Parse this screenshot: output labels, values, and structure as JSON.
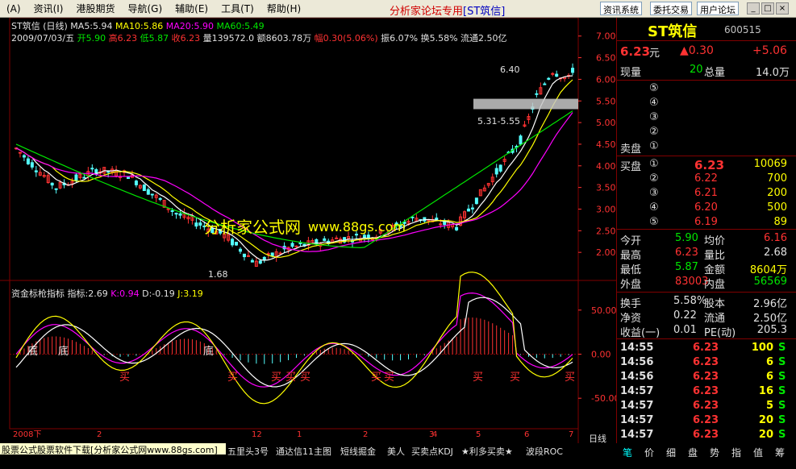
{
  "menu": {
    "items": [
      "(A)",
      "资讯(I)",
      "港股期货",
      "导航(G)",
      "辅助(E)",
      "工具(T)",
      "帮助(H)"
    ],
    "center_title": "分析家论坛专用",
    "center_title_stock": "[ST筑信]",
    "right_buttons": [
      "资讯系统",
      "委托交易",
      "用户论坛"
    ],
    "window_buttons": [
      "_",
      "□",
      "×"
    ]
  },
  "chart": {
    "info_line1": {
      "name": "ST筑信",
      "period": "(日线)",
      "ma5": "MA5:5.94",
      "ma10": "MA10:5.86",
      "ma20": "MA20:5.90",
      "ma60": "MA60:5.49"
    },
    "info_line2": {
      "date": "2009/07/03/五",
      "open": "开5.90",
      "high": "高6.23",
      "low": "低5.87",
      "close": "收6.23",
      "volume": "量139572.0",
      "amount": "额8603.78万",
      "change": "幅0.30(5.06%)",
      "amplitude": "振6.07%",
      "turnover": "换5.58%",
      "float": "流通2.50亿"
    },
    "price_axis": [
      "7.00",
      "6.50",
      "6.00",
      "5.50",
      "5.00",
      "4.50",
      "4.00",
      "3.50",
      "3.00",
      "2.50",
      "2.00"
    ],
    "annotations": {
      "high": "6.40",
      "low": "1.68",
      "range": "5.31-5.55"
    },
    "watermark": "分析家公式网",
    "watermark_url": "www.88gs.com",
    "indicator_title": "资金标枪指标",
    "indicator_values": {
      "zb": "指标:2.69",
      "k": "K:0.94",
      "d": "D:-0.19",
      "j": "J:3.19"
    },
    "indicator_axis": [
      "50.00",
      "0.00",
      "-50.00"
    ],
    "signal_di": "底",
    "signal_mai": "买",
    "date_axis": [
      "2008下",
      "2",
      "12",
      "1",
      "2",
      "3",
      "4",
      "5",
      "6",
      "7"
    ],
    "period_label": "日线"
  },
  "quote": {
    "name": "ST筑信",
    "code": "600515",
    "price": "6.23",
    "price_unit": "元",
    "change": "▲0.30",
    "change_pct": "+5.06",
    "now_vol_label": "现量",
    "now_vol": "20",
    "total_vol_label": "总量",
    "total_vol": "14.0万",
    "sell_label": "卖盘",
    "sell_levels": [
      "⑤",
      "④",
      "③",
      "②",
      "①"
    ],
    "buy_label": "买盘",
    "buy_levels": [
      {
        "lvl": "①",
        "price": "6.23",
        "vol": "10069"
      },
      {
        "lvl": "②",
        "price": "6.22",
        "vol": "700"
      },
      {
        "lvl": "③",
        "price": "6.21",
        "vol": "200"
      },
      {
        "lvl": "④",
        "price": "6.20",
        "vol": "500"
      },
      {
        "lvl": "⑤",
        "price": "6.19",
        "vol": "89"
      }
    ],
    "stats": [
      {
        "l1": "今开",
        "v1": "5.90",
        "c1": "green",
        "l2": "均价",
        "v2": "6.16",
        "c2": "red"
      },
      {
        "l1": "最高",
        "v1": "6.23",
        "c1": "red",
        "l2": "量比",
        "v2": "2.68",
        "c2": "white"
      },
      {
        "l1": "最低",
        "v1": "5.87",
        "c1": "green",
        "l2": "金额",
        "v2": "8604万",
        "c2": "yellow"
      },
      {
        "l1": "外盘",
        "v1": "83003",
        "c1": "red",
        "l2": "内盘",
        "v2": "56569",
        "c2": "green"
      }
    ],
    "stats2": [
      {
        "l1": "换手",
        "v1": "5.58%",
        "l2": "股本",
        "v2": "2.96亿"
      },
      {
        "l1": "净资",
        "v1": "0.22",
        "l2": "流通",
        "v2": "2.50亿"
      },
      {
        "l1": "收益(一)",
        "v1": "0.01",
        "l2": "PE(动)",
        "v2": "205.3"
      }
    ],
    "ticks": [
      {
        "time": "14:55",
        "price": "6.23",
        "vol": "100",
        "bs": "S"
      },
      {
        "time": "14:56",
        "price": "6.23",
        "vol": "6",
        "bs": "S"
      },
      {
        "time": "14:56",
        "price": "6.23",
        "vol": "6",
        "bs": "S"
      },
      {
        "time": "14:57",
        "price": "6.23",
        "vol": "16",
        "bs": "S"
      },
      {
        "time": "14:57",
        "price": "6.23",
        "vol": "5",
        "bs": "S"
      },
      {
        "time": "14:57",
        "price": "6.23",
        "vol": "20",
        "bs": "S"
      },
      {
        "time": "14:57",
        "price": "6.23",
        "vol": "20",
        "bs": "S"
      }
    ]
  },
  "bottom": {
    "banner": "股票公式股票软件下载[分析家公式网www.88gs.com]",
    "tabs": [
      "五里头3号",
      "通达信11主图",
      "短线掘金",
      "美人",
      "买卖点KDJ",
      "★利多买卖★",
      "波段ROC"
    ],
    "right_tabs": [
      "笔",
      "价",
      "细",
      "盘",
      "势",
      "指",
      "值",
      "筹"
    ]
  }
}
